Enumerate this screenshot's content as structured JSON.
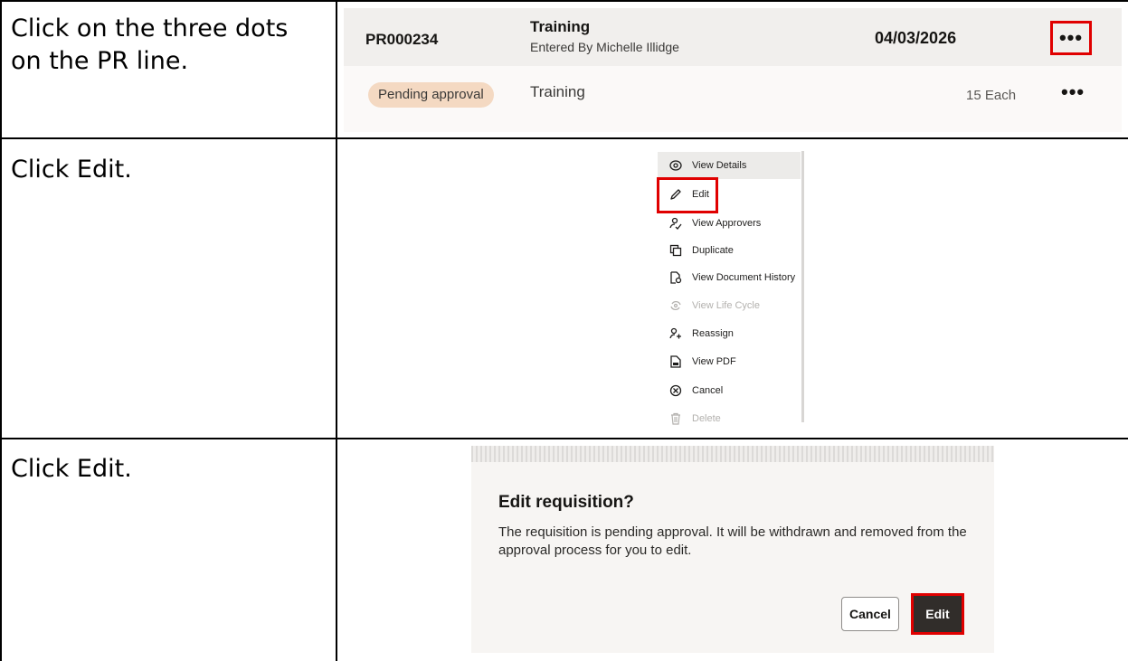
{
  "steps": [
    {
      "instruction": "Click on the three dots on the PR line."
    },
    {
      "instruction": "Click Edit."
    },
    {
      "instruction": "Click Edit."
    }
  ],
  "pr_card": {
    "number": "PR000234",
    "title": "Training",
    "entered_by": "Entered By Michelle Illidge",
    "date": "04/03/2026",
    "actions_glyph": "•••",
    "status_badge": "Pending approval",
    "line_title": "Training",
    "quantity": "15 Each",
    "line_actions_glyph": "•••"
  },
  "action_menu": {
    "items": [
      {
        "label": "View Details",
        "icon": "eye-icon",
        "enabled": true
      },
      {
        "label": "Edit",
        "icon": "pencil-icon",
        "enabled": true
      },
      {
        "label": "View Approvers",
        "icon": "approvers-icon",
        "enabled": true
      },
      {
        "label": "Duplicate",
        "icon": "duplicate-icon",
        "enabled": true
      },
      {
        "label": "View Document History",
        "icon": "document-history-icon",
        "enabled": true
      },
      {
        "label": "View Life Cycle",
        "icon": "life-cycle-icon",
        "enabled": false
      },
      {
        "label": "Reassign",
        "icon": "reassign-icon",
        "enabled": true
      },
      {
        "label": "View PDF",
        "icon": "pdf-icon",
        "enabled": true
      },
      {
        "label": "Cancel",
        "icon": "cancel-circle-icon",
        "enabled": true
      },
      {
        "label": "Delete",
        "icon": "trash-icon",
        "enabled": false
      }
    ]
  },
  "dialog": {
    "title": "Edit requisition?",
    "body": "The requisition is pending approval. It will be withdrawn and removed from the approval process for you to edit.",
    "cancel_label": "Cancel",
    "edit_label": "Edit"
  },
  "colors": {
    "highlight_box": "#e00000",
    "badge_bg": "#f4d9c2",
    "primary_button": "#312d2a"
  }
}
